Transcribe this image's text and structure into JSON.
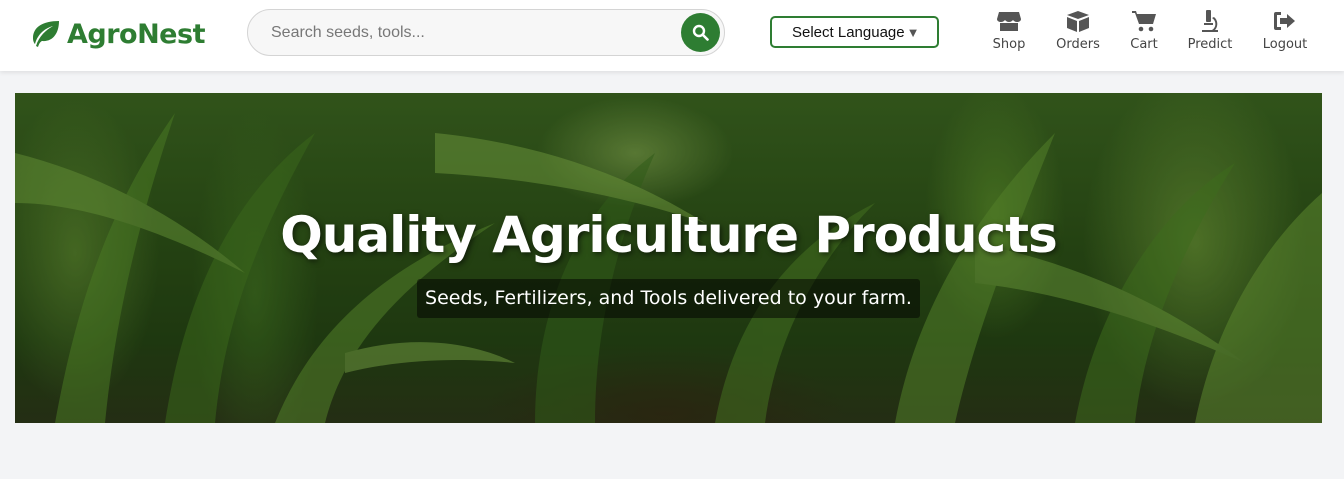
{
  "brand": {
    "name": "AgroNest",
    "color": "#2e7d32",
    "icon": "leaf-icon"
  },
  "search": {
    "placeholder": "Search seeds, tools...",
    "value": "",
    "icon": "search-icon"
  },
  "language": {
    "label": "Select Language",
    "caret": "▼"
  },
  "nav": {
    "items": [
      {
        "label": "Shop",
        "icon": "store-icon"
      },
      {
        "label": "Orders",
        "icon": "box-icon"
      },
      {
        "label": "Cart",
        "icon": "cart-icon"
      },
      {
        "label": "Predict",
        "icon": "microscope-icon"
      },
      {
        "label": "Logout",
        "icon": "logout-icon"
      }
    ]
  },
  "hero": {
    "title": "Quality Agriculture Products",
    "subtitle": "Seeds, Fertilizers, and Tools delivered to your farm."
  }
}
